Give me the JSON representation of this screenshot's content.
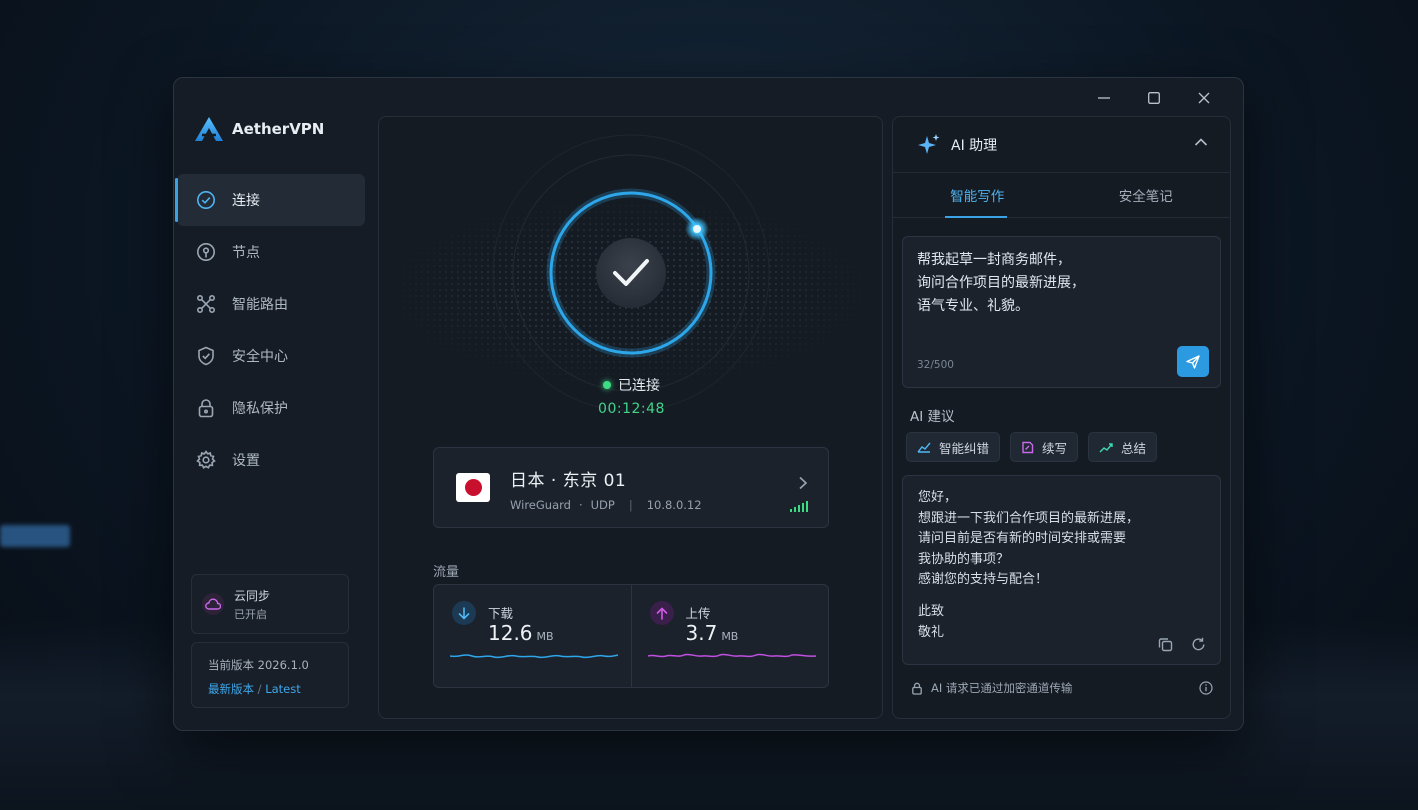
{
  "window": {
    "controls": [
      "minimize",
      "maximize",
      "close"
    ]
  },
  "brand": {
    "name": "AetherVPN",
    "icon": "aether-logo-icon"
  },
  "sidebar": {
    "items": [
      {
        "label": "连接",
        "icon": "check-circle-icon",
        "active": true
      },
      {
        "label": "节点",
        "icon": "location-pin-icon",
        "active": false
      },
      {
        "label": "智能路由",
        "icon": "route-network-icon",
        "active": false
      },
      {
        "label": "安全中心",
        "icon": "shield-check-icon",
        "active": false
      },
      {
        "label": "隐私保护",
        "icon": "lock-icon",
        "active": false
      },
      {
        "label": "设置",
        "icon": "gear-icon",
        "active": false
      }
    ],
    "cloud": {
      "title": "云同步",
      "status": "已开启"
    },
    "version": {
      "label": "当前版本 2026.1.0",
      "latest": "最新版本",
      "sep": "/",
      "latest_en": "Latest"
    }
  },
  "connection": {
    "status": "已连接",
    "timer": "00:12:48",
    "server": {
      "name": "日本 · 东京 01",
      "protocol": "WireGuard",
      "dot": "·",
      "transport": "UDP",
      "divider": "|",
      "ip": "10.8.0.12"
    },
    "traffic_label": "流量",
    "download": {
      "label": "下载",
      "value": "12.6",
      "unit": "MB"
    },
    "upload": {
      "label": "上传",
      "value": "3.7",
      "unit": "MB"
    }
  },
  "ai": {
    "title": "AI 助理",
    "tabs": [
      {
        "label": "智能写作",
        "active": true
      },
      {
        "label": "安全笔记",
        "active": false
      }
    ],
    "prompt": "帮我起草一封商务邮件，\n询问合作项目的最新进展，\n语气专业、礼貌。",
    "counter": "32/500",
    "suggestions_label": "AI 建议",
    "chips": [
      {
        "label": "智能纠错",
        "icon": "chart-check-icon"
      },
      {
        "label": "续写",
        "icon": "edit-note-icon"
      },
      {
        "label": "总结",
        "icon": "chart-trend-icon"
      }
    ],
    "result_lines": [
      "您好，",
      "想跟进一下我们合作项目的最新进展，",
      "请问目前是否有新的时间安排或需要",
      "我协助的事项？",
      "感谢您的支持与配合！"
    ],
    "result_sign": [
      "此致",
      "敬礼"
    ],
    "footer": "AI 请求已通过加密通道传输"
  },
  "colors": {
    "accent": "#3aa3e6",
    "connected": "#3ddc84",
    "upload": "#c050e0"
  }
}
